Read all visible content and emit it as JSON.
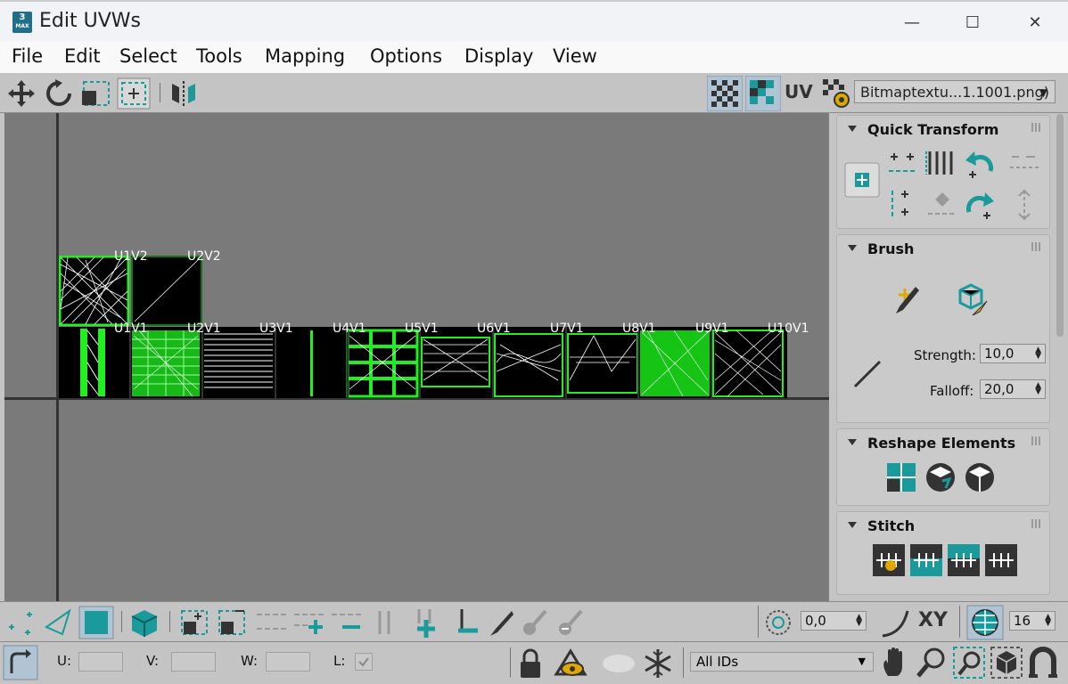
{
  "window": {
    "title": "Edit UVWs",
    "icon_text": "3",
    "icon_subtext": "MAX",
    "controls": {
      "minimize": "—",
      "maximize": "☐",
      "close": "✕"
    }
  },
  "menubar": {
    "items": [
      {
        "label": "File"
      },
      {
        "label": "Edit"
      },
      {
        "label": "Select"
      },
      {
        "label": "Tools"
      },
      {
        "label": "Mapping"
      },
      {
        "label": "Options"
      },
      {
        "label": "Display"
      },
      {
        "label": "View"
      }
    ]
  },
  "toolbar": {
    "uv_label": "UV",
    "texture_dropdown": "Bitmaptextu...1.1001.png)"
  },
  "viewport": {
    "tiles": [
      {
        "label": "U1V2"
      },
      {
        "label": "U2V2"
      },
      {
        "label": "U1V1"
      },
      {
        "label": "U2V1"
      },
      {
        "label": "U3V1"
      },
      {
        "label": "U4V1"
      },
      {
        "label": "U5V1"
      },
      {
        "label": "U6V1"
      },
      {
        "label": "U7V1"
      },
      {
        "label": "U8V1"
      },
      {
        "label": "U9V1"
      },
      {
        "label": "U10V1"
      }
    ],
    "wire_color": "#22ee22",
    "background_color": "#7a7a7a"
  },
  "panel": {
    "quick_transform": {
      "title": "Quick Transform"
    },
    "brush": {
      "title": "Brush",
      "strength_label": "Strength:",
      "strength_value": "10,0",
      "falloff_label": "Falloff:",
      "falloff_value": "20,0"
    },
    "reshape": {
      "title": "Reshape Elements"
    },
    "stitch": {
      "title": "Stitch"
    }
  },
  "bottom_toolbar": {
    "soft_select_value": "0,0",
    "xy_label": "XY",
    "grid_value": "16"
  },
  "status_bar": {
    "u_label": "U:",
    "v_label": "V:",
    "w_label": "W:",
    "l_label": "L:",
    "id_dropdown": "All IDs"
  },
  "colors": {
    "accent": "#1a9a9a",
    "panel_bg": "#c4c4c4"
  }
}
